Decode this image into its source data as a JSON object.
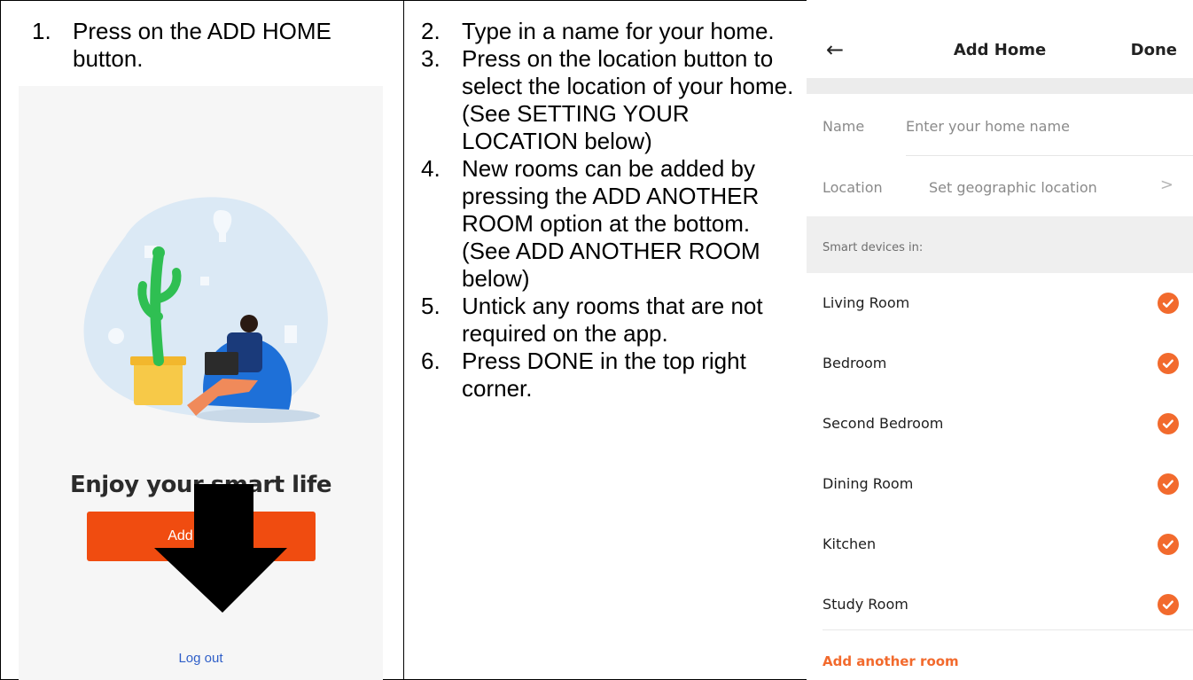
{
  "left_instructions": [
    {
      "num": "1.",
      "text": "Press on the ADD HOME button."
    }
  ],
  "middle_instructions": [
    {
      "num": "2.",
      "text": "Type in a name for your home."
    },
    {
      "num": "3.",
      "text": "Press on the location button to select the location of your home. (See SETTING YOUR LOCATION below)"
    },
    {
      "num": "4.",
      "text": "New rooms can be added by pressing the ADD ANOTHER ROOM option at the bottom. (See ADD ANOTHER ROOM below)"
    },
    {
      "num": "5.",
      "text": "Untick any rooms that are not required on the app."
    },
    {
      "num": "6.",
      "text": "Press DONE in the top right corner."
    }
  ],
  "welcome_screen": {
    "tagline": "Enjoy your smart life",
    "add_home_button": "Add Home",
    "logout_link": "Log out"
  },
  "add_home_screen": {
    "back_icon": "arrow-left-icon",
    "title": "Add Home",
    "done_button": "Done",
    "name_label": "Name",
    "name_placeholder": "Enter your home name",
    "location_label": "Location",
    "location_placeholder": "Set geographic location",
    "location_chevron": ">",
    "section_header": "Smart devices in:",
    "rooms": [
      {
        "name": "Living Room",
        "checked": true
      },
      {
        "name": "Bedroom",
        "checked": true
      },
      {
        "name": "Second Bedroom",
        "checked": true
      },
      {
        "name": "Dining Room",
        "checked": true
      },
      {
        "name": "Kitchen",
        "checked": true
      },
      {
        "name": "Study Room",
        "checked": true
      }
    ],
    "add_room_link": "Add another room"
  },
  "colors": {
    "accent_orange": "#f26a2d",
    "button_orange": "#f04c10",
    "link_blue": "#2f5fc8"
  }
}
